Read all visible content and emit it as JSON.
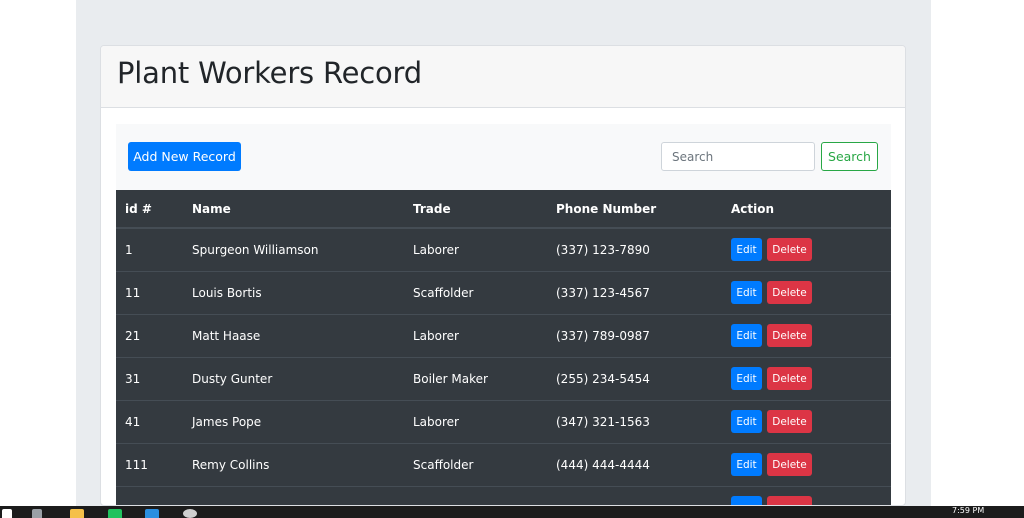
{
  "header": {
    "title": "Plant Workers Record"
  },
  "toolbar": {
    "add_label": "Add New Record",
    "search_placeholder": "Search",
    "search_value": "",
    "search_button": "Search"
  },
  "table": {
    "columns": [
      "id #",
      "Name",
      "Trade",
      "Phone Number",
      "Action"
    ],
    "edit_label": "Edit",
    "delete_label": "Delete",
    "rows": [
      {
        "id": "1",
        "name": "Spurgeon Williamson",
        "trade": "Laborer",
        "phone": "(337) 123-7890"
      },
      {
        "id": "11",
        "name": "Louis Bortis",
        "trade": "Scaffolder",
        "phone": "(337) 123-4567"
      },
      {
        "id": "21",
        "name": "Matt Haase",
        "trade": "Laborer",
        "phone": "(337) 789-0987"
      },
      {
        "id": "31",
        "name": "Dusty Gunter",
        "trade": "Boiler Maker",
        "phone": "(255) 234-5454"
      },
      {
        "id": "41",
        "name": "James Pope",
        "trade": "Laborer",
        "phone": "(347) 321-1563"
      },
      {
        "id": "111",
        "name": "Remy Collins",
        "trade": "Scaffolder",
        "phone": "(444) 444-4444"
      }
    ]
  },
  "taskbar": {
    "time": "7:59 PM",
    "icons": [
      "windows-icon",
      "search-icon",
      "task-view-icon",
      "file-explorer-icon",
      "app-green-icon",
      "vscode-icon",
      "obs-icon"
    ]
  },
  "colors": {
    "primary": "#007bff",
    "danger": "#dc3545",
    "success": "#28a745",
    "table_dark": "#343a40"
  }
}
